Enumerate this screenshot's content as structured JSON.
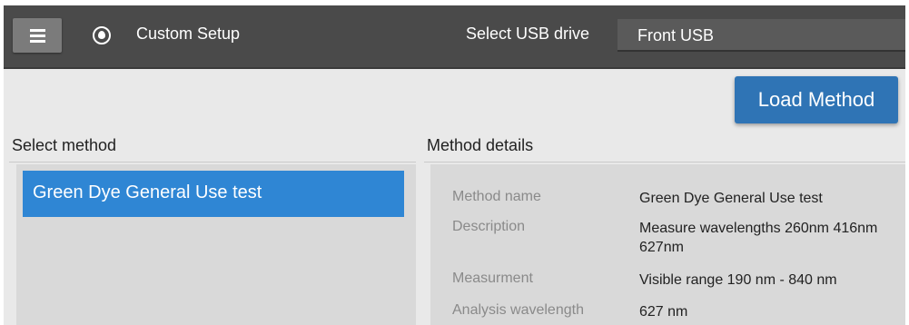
{
  "header": {
    "app_title": "Custom Setup",
    "usb_label": "Select USB drive",
    "usb_value": "Front USB",
    "icons": {
      "menu": "hamburger-menu-icon",
      "app": "drop-in-circle-icon"
    }
  },
  "actions": {
    "load_method": "Load Method"
  },
  "select_method": {
    "label": "Select method",
    "items": [
      {
        "label": "Green Dye General Use test",
        "selected": true
      }
    ]
  },
  "method_details": {
    "label": "Method details",
    "rows": [
      {
        "key": "Method name",
        "value": "Green Dye General Use test"
      },
      {
        "key": "Description",
        "value": "Measure wavelengths 260nm 416nm 627nm"
      },
      {
        "key": "Measurment",
        "value": "Visible range 190 nm - 840 nm"
      },
      {
        "key": "Analysis wavelength",
        "value": "627 nm"
      }
    ]
  },
  "colors": {
    "topbar": "#4a4a4a",
    "accent": "#2f74b5",
    "selected_item": "#2f86d4",
    "panel": "#d9d9d9",
    "background": "#e9e9e9"
  }
}
